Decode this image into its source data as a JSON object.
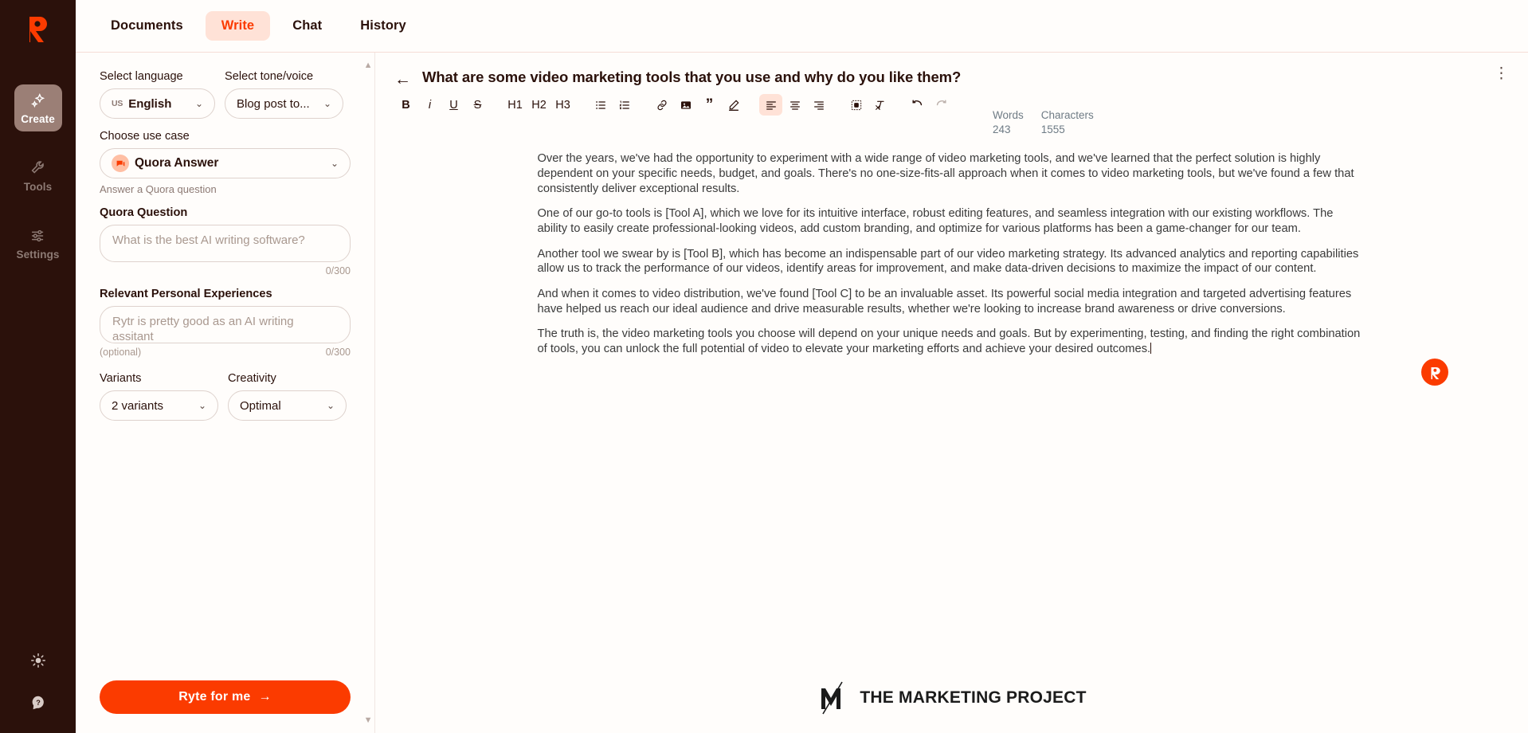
{
  "brand": {
    "logo_letter": "R",
    "accent": "#fb3b00",
    "rail_bg": "#2b110b"
  },
  "rail": {
    "items": [
      {
        "label": "Create",
        "icon": "sparkles-icon",
        "active": true
      },
      {
        "label": "Tools",
        "icon": "wrench-icon",
        "active": false
      },
      {
        "label": "Settings",
        "icon": "sliders-icon",
        "active": false
      }
    ],
    "bottom": [
      {
        "label": "Theme",
        "icon": "sun-icon"
      },
      {
        "label": "Help",
        "icon": "help-icon"
      }
    ]
  },
  "topbar": {
    "tabs": [
      {
        "label": "Documents",
        "active": false
      },
      {
        "label": "Write",
        "active": true
      },
      {
        "label": "Chat",
        "active": false
      },
      {
        "label": "History",
        "active": false
      }
    ]
  },
  "panel": {
    "language": {
      "label": "Select language",
      "flag": "US",
      "value": "English"
    },
    "tone": {
      "label": "Select tone/voice",
      "value": "Blog post to..."
    },
    "use_case": {
      "label": "Choose use case",
      "value": "Quora Answer",
      "helper": "Answer a Quora question",
      "icon": "chat-bubble-icon"
    },
    "quora_question": {
      "label": "Quora Question",
      "placeholder": "What is the best AI writing software?",
      "value": "",
      "counter": "0/300"
    },
    "experiences": {
      "label": "Relevant Personal Experiences",
      "placeholder": "Rytr is pretty good as an AI writing assitant",
      "value": "",
      "optional_note": "(optional)",
      "counter": "0/300"
    },
    "variants": {
      "label": "Variants",
      "value": "2 variants"
    },
    "creativity": {
      "label": "Creativity",
      "value": "Optimal"
    },
    "cta": {
      "label": "Ryte for me",
      "arrow": "→"
    }
  },
  "editor": {
    "back_icon": "back-arrow-icon",
    "title": "What are some video marketing tools that you use and why do you like them?",
    "menu_icon": "kebab-menu-icon",
    "stats": [
      {
        "label": "Words",
        "value": "243"
      },
      {
        "label": "Characters",
        "value": "1555"
      }
    ],
    "toolbar": [
      {
        "name": "bold",
        "glyph": "B",
        "active": false
      },
      {
        "name": "italic",
        "glyph": "i",
        "active": false
      },
      {
        "name": "underline",
        "glyph": "U",
        "active": false
      },
      {
        "name": "strikethrough",
        "glyph": "S",
        "active": false
      },
      {
        "name": "heading-1",
        "glyph": "H1",
        "active": false
      },
      {
        "name": "heading-2",
        "glyph": "H2",
        "active": false
      },
      {
        "name": "heading-3",
        "glyph": "H3",
        "active": false
      },
      {
        "name": "bullet-list",
        "glyph": "",
        "active": false
      },
      {
        "name": "numbered-list",
        "glyph": "",
        "active": false
      },
      {
        "name": "link",
        "glyph": "",
        "active": false
      },
      {
        "name": "image",
        "glyph": "",
        "active": false
      },
      {
        "name": "blockquote",
        "glyph": "”",
        "active": false
      },
      {
        "name": "highlighter",
        "glyph": "",
        "active": false
      },
      {
        "name": "align-left",
        "glyph": "",
        "active": true
      },
      {
        "name": "align-center",
        "glyph": "",
        "active": false
      },
      {
        "name": "align-right",
        "glyph": "",
        "active": false
      },
      {
        "name": "insert-block",
        "glyph": "",
        "active": false
      },
      {
        "name": "clear-format",
        "glyph": "",
        "active": false
      },
      {
        "name": "undo",
        "glyph": "",
        "active": false
      },
      {
        "name": "redo",
        "glyph": "",
        "active": false
      }
    ],
    "paragraphs": [
      "Over the years, we've had the opportunity to experiment with a wide range of video marketing tools, and we've learned that the perfect solution is highly dependent on your specific needs, budget, and goals. There's no one-size-fits-all approach when it comes to video marketing tools, but we've found a few that consistently deliver exceptional results.",
      "One of our go-to tools is [Tool A], which we love for its intuitive interface, robust editing features, and seamless integration with our existing workflows. The ability to easily create professional-looking videos, add custom branding, and optimize for various platforms has been a game-changer for our team.",
      "Another tool we swear by is [Tool B], which has become an indispensable part of our video marketing strategy. Its advanced analytics and reporting capabilities allow us to track the performance of our videos, identify areas for improvement, and make data-driven decisions to maximize the impact of our content.",
      "And when it comes to video distribution, we've found [Tool C] to be an invaluable asset. Its powerful social media integration and targeted advertising features have helped us reach our ideal audience and drive measurable results, whether we're looking to increase brand awareness or drive conversions.",
      "The truth is, the video marketing tools you choose will depend on your unique needs and goals. But by experimenting, testing, and finding the right combination of tools, you can unlock the full potential of video to elevate your marketing efforts and achieve your desired outcomes."
    ],
    "assistant_badge": "R",
    "footer_logo_text": "THE MARKETING PROJECT"
  }
}
